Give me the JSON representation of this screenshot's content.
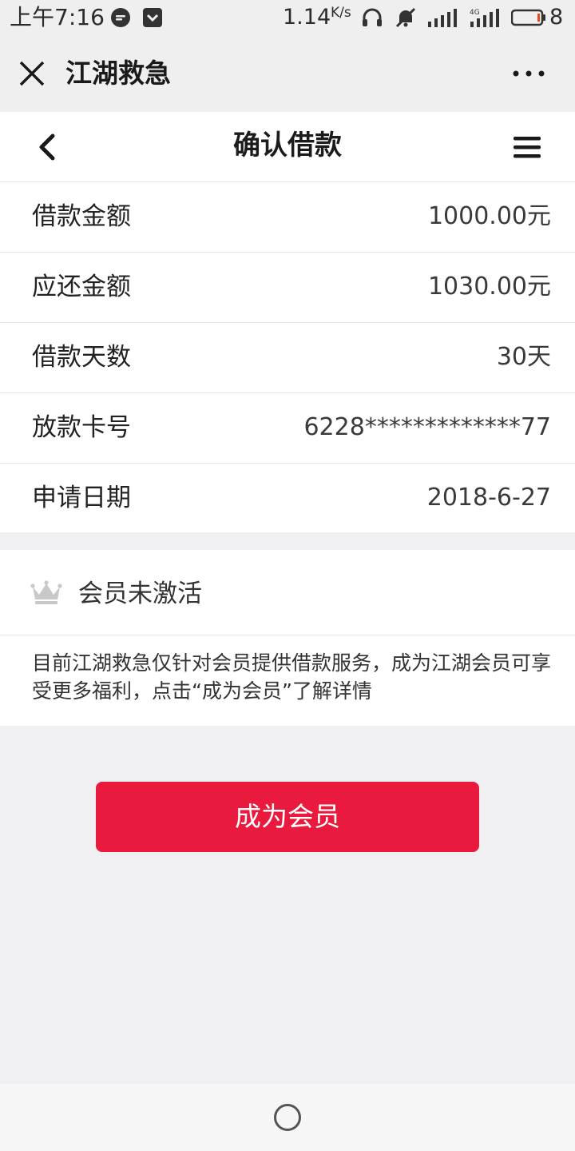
{
  "status_bar": {
    "time": "上午7:16",
    "speed": "1.14",
    "speed_unit": "K/s",
    "battery_level": "8"
  },
  "app_bar": {
    "title": "江湖救急",
    "close_icon": "close-icon",
    "more_icon": "more-icon"
  },
  "page_header": {
    "title": "确认借款",
    "back_icon": "chevron-left-icon",
    "menu_icon": "menu-icon"
  },
  "loan_info": [
    {
      "label": "借款金额",
      "value": "1000.00元"
    },
    {
      "label": "应还金额",
      "value": "1030.00元"
    },
    {
      "label": "借款天数",
      "value": "30天"
    },
    {
      "label": "放款卡号",
      "value": "6228*************77"
    },
    {
      "label": "申请日期",
      "value": "2018-6-27"
    }
  ],
  "membership": {
    "icon": "crown-icon",
    "status": "会员未激活",
    "description": "目前江湖救急仅针对会员提供借款服务，成为江湖会员可享受更多福利，点击“成为会员”了解详情"
  },
  "action_button": {
    "label": "成为会员"
  },
  "colors": {
    "accent": "#ea1a3e",
    "page_background": "#f0f0f2",
    "crown_gray": "#c8c8c8"
  }
}
